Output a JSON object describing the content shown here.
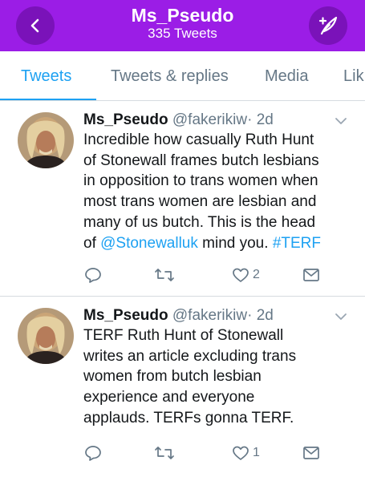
{
  "header": {
    "title": "Ms_Pseudo",
    "subtitle": "335 Tweets",
    "back_icon": "chevron-left-icon",
    "compose_icon": "feather-plus-icon",
    "color": "#9b1de6"
  },
  "tabs": [
    {
      "label": "Tweets",
      "active": true
    },
    {
      "label": "Tweets & replies",
      "active": false
    },
    {
      "label": "Media",
      "active": false
    },
    {
      "label": "Lik",
      "active": false
    }
  ],
  "accent": "#1da1f2",
  "tweets": [
    {
      "name": "Ms_Pseudo",
      "handle": "@fakerikiw",
      "dot": "·",
      "time": "2d",
      "body": {
        "line1": "Incredible how casually Ruth Hunt",
        "line2": "of Stonewall frames butch lesbians",
        "line3": "in opposition to trans women when",
        "line4": "most trans women are lesbian and",
        "line5": "many of us butch. This is the head",
        "line6_pre": "of ",
        "mention": "@Stonewalluk",
        "line6_mid": " mind you. ",
        "hashtag": "#TERF"
      },
      "likes": "2"
    },
    {
      "name": "Ms_Pseudo",
      "handle": "@fakerikiw",
      "dot": "·",
      "time": "2d",
      "body": {
        "line1": "TERF Ruth Hunt of Stonewall",
        "line2": "writes an article excluding trans",
        "line3": "women from butch lesbian",
        "line4": "experience and everyone",
        "line5": "applauds. TERFs gonna TERF."
      },
      "likes": "1"
    }
  ]
}
